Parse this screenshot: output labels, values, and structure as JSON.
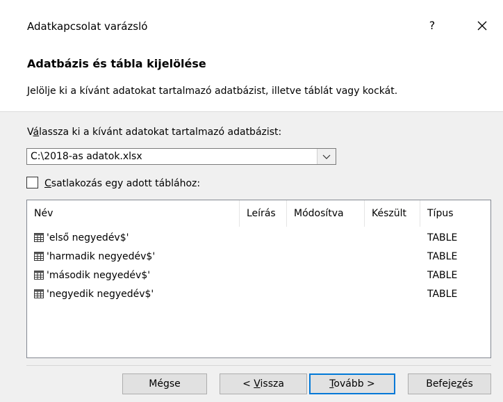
{
  "window": {
    "title": "Adatkapcsolat varázsló",
    "help_label": "?"
  },
  "header": {
    "heading": "Adatbázis és tábla kijelölése",
    "description": "Jelölje ki a kívánt adatokat tartalmazó adatbázist, illetve táblát vagy kockát."
  },
  "database": {
    "label_pre": "V",
    "label_underlined": "á",
    "label_post": "lassza ki a kívánt adatokat tartalmazó adatbázist:",
    "selected_value": "C:\\2018-as adatok.xlsx"
  },
  "connect_checkbox": {
    "label_underlined": "C",
    "label_rest": "satlakozás egy adott táblához:",
    "checked": false
  },
  "table_list": {
    "columns": [
      {
        "label": "Név"
      },
      {
        "label": "Leírás"
      },
      {
        "label": "Módosítva"
      },
      {
        "label": "Készült"
      },
      {
        "label": "Típus"
      }
    ],
    "rows": [
      {
        "name": "'első negyedév$'",
        "type": "TABLE"
      },
      {
        "name": "'harmadik negyedév$'",
        "type": "TABLE"
      },
      {
        "name": "'második negyedév$'",
        "type": "TABLE"
      },
      {
        "name": "'negyedik negyedév$'",
        "type": "TABLE"
      }
    ]
  },
  "buttons": {
    "cancel": "Mégse",
    "back_pre": "< ",
    "back_underlined": "V",
    "back_post": "issza",
    "next_underlined": "T",
    "next_post": "ovább >",
    "finish_pre": "Befeje",
    "finish_underlined": "z",
    "finish_post": "és"
  }
}
